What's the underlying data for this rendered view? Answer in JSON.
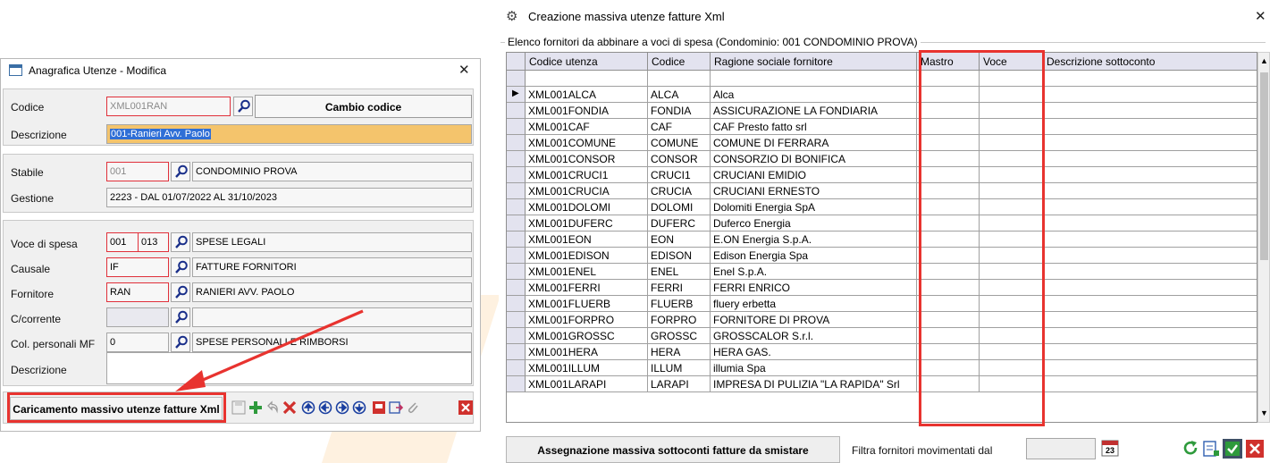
{
  "left_window": {
    "title": "Anagrafica Utenze - Modifica",
    "fields": {
      "codice": {
        "label": "Codice",
        "value": "XML001RAN"
      },
      "cambio_codice": "Cambio codice",
      "descrizione": {
        "label": "Descrizione",
        "value": "001-Ranieri Avv. Paolo"
      },
      "stabile": {
        "label": "Stabile",
        "value": "001",
        "text": "CONDOMINIO PROVA"
      },
      "gestione": {
        "label": "Gestione",
        "value": "2223 - DAL 01/07/2022 AL 31/10/2023"
      },
      "voce_di_spesa": {
        "label": "Voce di spesa",
        "value1": "001",
        "value2": "013",
        "text": "SPESE LEGALI"
      },
      "causale": {
        "label": "Causale",
        "value": "IF",
        "text": "FATTURE FORNITORI"
      },
      "fornitore": {
        "label": "Fornitore",
        "value": "RAN",
        "text": "RANIERI AVV. PAOLO"
      },
      "c_corrente": {
        "label": "C/corrente",
        "value": "",
        "text": ""
      },
      "col_personali": {
        "label": "Col. personali MF",
        "value": "0",
        "text": "SPESE PERSONALI E RIMBORSI"
      },
      "descrizione2": {
        "label": "Descrizione",
        "value": ""
      }
    },
    "bulk_button": "Caricamento massivo utenze fatture Xml"
  },
  "right_window": {
    "title": "Creazione massiva utenze fatture Xml",
    "group_caption": "Elenco fornitori da abbinare a voci di spesa (Condominio: 001 CONDOMINIO PROVA)",
    "columns": [
      "Codice utenza",
      "Codice",
      "Ragione sociale fornitore",
      "Mastro",
      "Voce",
      "Descrizione sottoconto"
    ],
    "rows": [
      [
        "XML001ALCA",
        "ALCA",
        "Alca"
      ],
      [
        "XML001FONDIA",
        "FONDIA",
        "ASSICURAZIONE LA FONDIARIA"
      ],
      [
        "XML001CAF",
        "CAF",
        "CAF Presto fatto srl"
      ],
      [
        "XML001COMUNE",
        "COMUNE",
        "COMUNE DI FERRARA"
      ],
      [
        "XML001CONSOR",
        "CONSOR",
        "CONSORZIO DI BONIFICA"
      ],
      [
        "XML001CRUCI1",
        "CRUCI1",
        "CRUCIANI EMIDIO"
      ],
      [
        "XML001CRUCIA",
        "CRUCIA",
        "CRUCIANI ERNESTO"
      ],
      [
        "XML001DOLOMI",
        "DOLOMI",
        "Dolomiti Energia SpA"
      ],
      [
        "XML001DUFERC",
        "DUFERC",
        "Duferco Energia"
      ],
      [
        "XML001EON",
        "EON",
        "E.ON Energia S.p.A."
      ],
      [
        "XML001EDISON",
        "EDISON",
        "Edison Energia Spa"
      ],
      [
        "XML001ENEL",
        "ENEL",
        "Enel S.p.A."
      ],
      [
        "XML001FERRI",
        "FERRI",
        "FERRI ENRICO"
      ],
      [
        "XML001FLUERB",
        "FLUERB",
        "fluery erbetta"
      ],
      [
        "XML001FORPRO",
        "FORPRO",
        "FORNITORE DI PROVA"
      ],
      [
        "XML001GROSSC",
        "GROSSC",
        "GROSSCALOR S.r.l."
      ],
      [
        "XML001HERA",
        "HERA",
        "HERA GAS."
      ],
      [
        "XML001ILLUM",
        "ILLUM",
        "illumia Spa"
      ],
      [
        "XML001LARAPI",
        "LARAPI",
        "IMPRESA DI PULIZIA \"LA RAPIDA\" Srl"
      ]
    ],
    "assign_button": "Assegnazione massiva sottoconti fatture da smistare",
    "filter_label": "Filtra fornitori movimentati dal",
    "filter_value": "",
    "calendar_day": "23"
  },
  "colors": {
    "highlight": "#e8332f",
    "accent": "#2f6fd6"
  }
}
